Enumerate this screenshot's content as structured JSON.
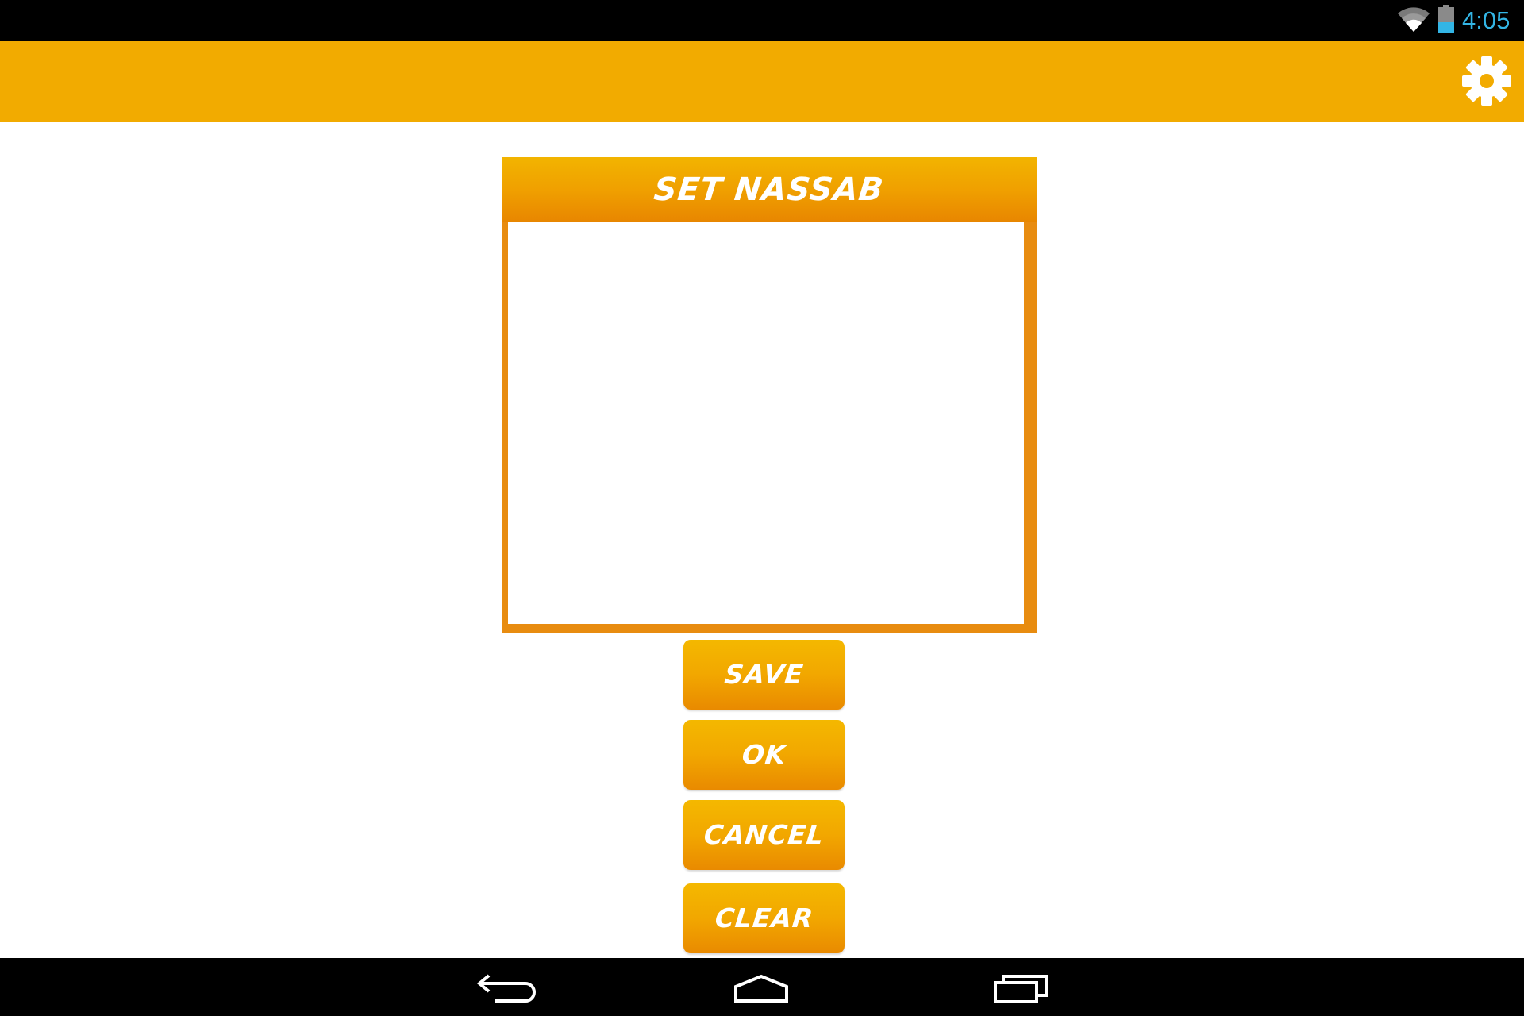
{
  "status_bar": {
    "time": "4:05",
    "icons": [
      "wifi-icon",
      "battery-icon"
    ]
  },
  "action_bar": {
    "settings_icon": "gear-icon"
  },
  "panel": {
    "title": "SET NASSAB"
  },
  "buttons": {
    "save": "SAVE",
    "ok": "OK",
    "cancel": "CANCEL",
    "clear": "CLEAR"
  },
  "nav_bar": {
    "icons": [
      "back-icon",
      "home-icon",
      "recents-icon"
    ]
  },
  "colors": {
    "accent": "#f2ab00",
    "panel_border": "#e88c10",
    "clock": "#33b5e5"
  }
}
